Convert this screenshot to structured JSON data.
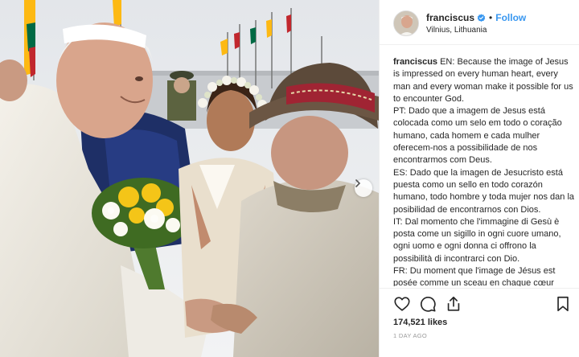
{
  "post": {
    "username": "franciscus",
    "verified": true,
    "separator": "•",
    "follow_label": "Follow",
    "location": "Vilnius, Lithuania",
    "caption": {
      "author": "franciscus",
      "paragraphs": [
        "EN: Because the image of Jesus is impressed on every human heart, every man and every woman make it possible for us to encounter God.",
        "PT: Dado que a imagem de Jesus está colocada como um selo em todo o coração humano, cada homem e cada mulher oferecem-nos a possibilidade de nos encontrarmos com Deus.",
        "ES: Dado que la imagen de Jesucristo está puesta como un sello en todo corazón humano, todo hombre y toda mujer nos dan la posibilidad de encontrarnos con Dios.",
        "IT: Dal momento che l'immagine di Gesù è posta come un sigillo in ogni cuore umano, ogni uomo e ogni donna ci offrono la possibilità di incontrarci con Dio.",
        "FR: Du moment que l'image de Jésus est posée comme un sceau en chaque cœur humain, chaque homme et chaque femme nous offrent la possibilité de rencontrer Dieu."
      ]
    },
    "likes_count": "174,521",
    "likes_label": "likes",
    "timestamp": "1 DAY AGO",
    "icons": {
      "like": "heart-icon",
      "comment": "comment-icon",
      "share": "share-icon",
      "save": "bookmark-icon",
      "next": "chevron-right-icon",
      "verified": "verified-badge-icon"
    },
    "colors": {
      "follow": "#3897f0",
      "verified": "#3897f0",
      "muted": "#999999"
    }
  }
}
